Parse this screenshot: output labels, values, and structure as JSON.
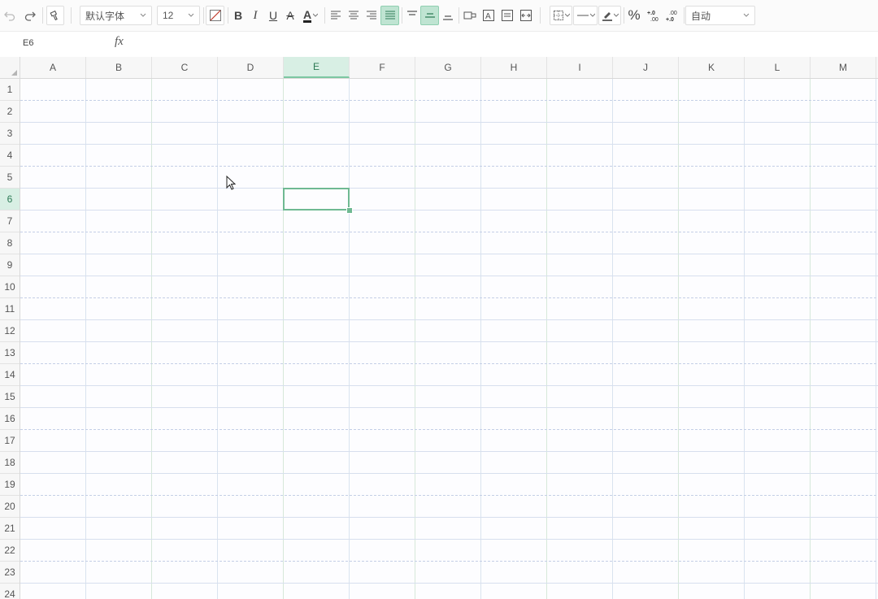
{
  "toolbar": {
    "font_name": "默认字体",
    "font_size": "12",
    "bold_label": "B",
    "italic_label": "I",
    "underline_label": "U",
    "strike_label": "A",
    "font_color_label": "A",
    "percent_label": "%",
    "number_format": "自动",
    "font_color_accent": "#2d7a55",
    "active_color": "#bfe4d2"
  },
  "formula_bar": {
    "cell_ref": "E6",
    "fx_label": "fx",
    "value": ""
  },
  "grid": {
    "columns": [
      "A",
      "B",
      "C",
      "D",
      "E",
      "F",
      "G",
      "H",
      "I",
      "J",
      "K",
      "L",
      "M"
    ],
    "rows": [
      "1",
      "2",
      "3",
      "4",
      "5",
      "6",
      "7",
      "8",
      "9",
      "10",
      "11",
      "12",
      "13",
      "14",
      "15",
      "16",
      "17",
      "18",
      "19",
      "20",
      "21",
      "22",
      "23",
      "24"
    ],
    "selected_cell": "E6",
    "selected_column": "E",
    "selected_row": "6"
  },
  "icons": {
    "undo": "undo-icon",
    "redo": "redo-icon",
    "format_painter": "format-painter-icon",
    "clear_format": "clear-format-icon",
    "align_left": "align-left-icon",
    "align_center": "align-center-icon",
    "align_right": "align-right-icon",
    "align_justify": "align-justify-icon",
    "valign_top": "valign-top-icon",
    "valign_middle": "valign-middle-icon",
    "valign_bottom": "valign-bottom-icon",
    "border": "border-icon",
    "line_style": "line-style-icon",
    "line_color": "line-color-icon",
    "increase_decimal": "increase-decimal-icon",
    "decrease_decimal": "decrease-decimal-icon"
  }
}
